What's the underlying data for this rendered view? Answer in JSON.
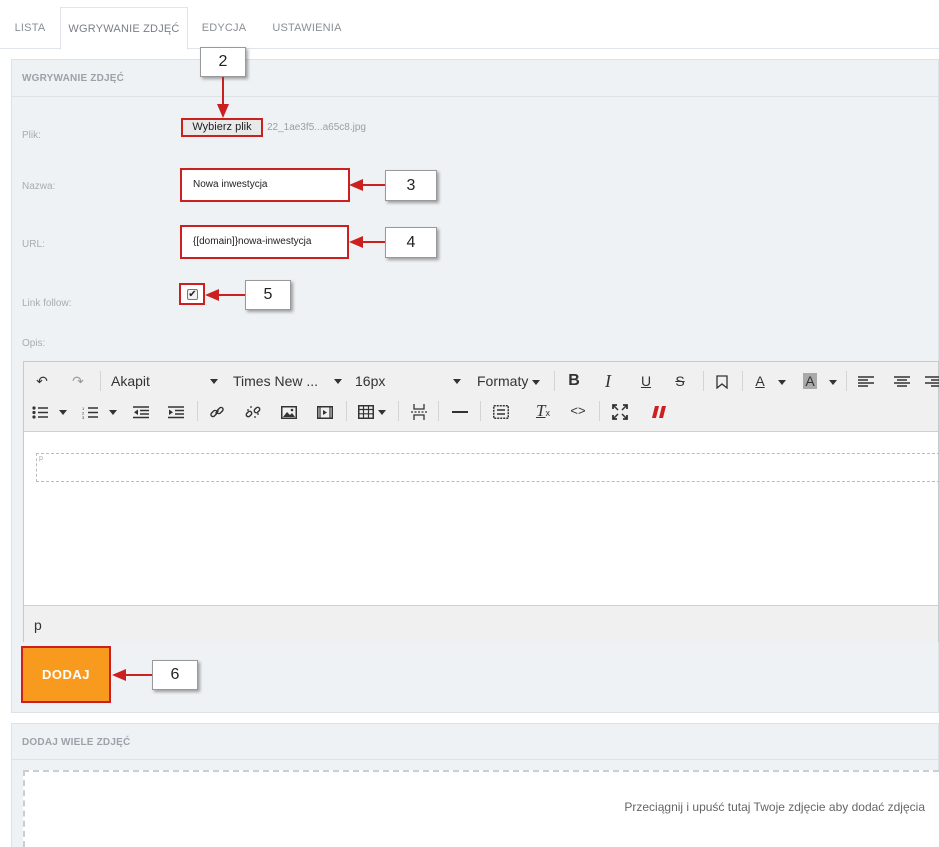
{
  "tabs": [
    {
      "label": "LISTA"
    },
    {
      "label": "WGRYWANIE ZDJĘĆ"
    },
    {
      "label": "EDYCJA"
    },
    {
      "label": "USTAWIENIA"
    }
  ],
  "upload_panel": {
    "title": "WGRYWANIE ZDJĘĆ",
    "file_label": "Plik:",
    "file_button": "Wybierz plik",
    "file_name": "22_1ae3f5...a65c8.jpg",
    "name_label": "Nazwa:",
    "name_value": "Nowa inwestycja",
    "url_label": "URL:",
    "url_value": "{[domain]}nowa-inwestycja",
    "link_follow_label": "Link follow:",
    "link_follow_checked": true,
    "description_label": "Opis:",
    "submit_label": "DODAJ"
  },
  "editor": {
    "block_format": "Akapit",
    "font_family": "Times New ...",
    "font_size": "16px",
    "formats": "Formaty",
    "status_path": "p",
    "para_marker": "p"
  },
  "callouts": {
    "c2": "2",
    "c3": "3",
    "c4": "4",
    "c5": "5",
    "c6": "6"
  },
  "multi_panel": {
    "title": "DODAJ WIELE ZDJĘĆ",
    "dropzone_text": "Przeciągnij i upuść tutaj Twoje zdjęcie aby dodać zdjęcia"
  },
  "colors": {
    "accent_orange": "#f79a1e",
    "annotation_red": "#cc1f1f",
    "panel_bg": "#eff2f5"
  }
}
